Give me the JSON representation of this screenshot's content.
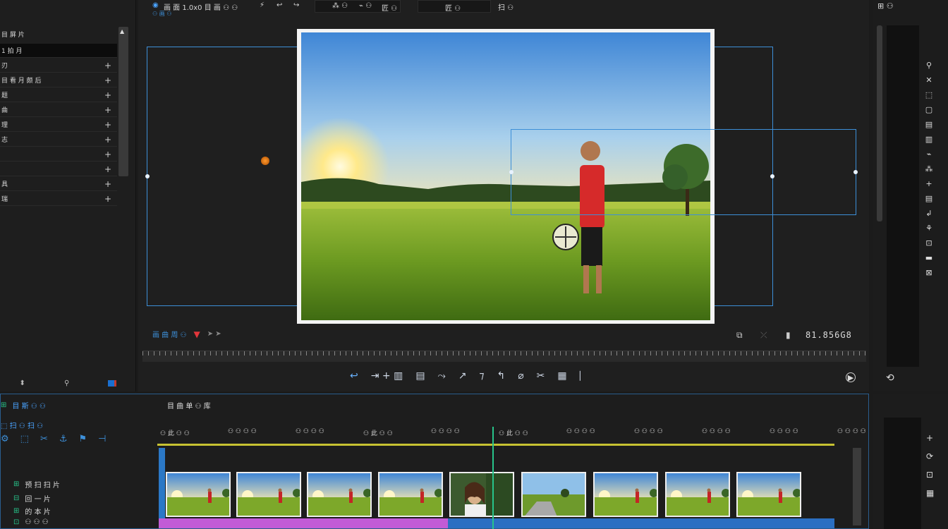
{
  "left_panel": {
    "header": "目 屏 片",
    "rows": [
      {
        "label": "1 拍 月",
        "selected": true,
        "plus": false,
        "back": "✚"
      },
      {
        "label": "刃",
        "selected": false,
        "plus": true
      },
      {
        "label": "目 看 月 颇 后",
        "selected": false,
        "plus": true
      },
      {
        "label": "题",
        "selected": false,
        "plus": true
      },
      {
        "label": "曲",
        "selected": false,
        "plus": true
      },
      {
        "label": "理",
        "selected": false,
        "plus": true
      },
      {
        "label": "志",
        "selected": false,
        "plus": true
      },
      {
        "label": "",
        "selected": false,
        "plus": true
      },
      {
        "label": "",
        "selected": false,
        "plus": true
      },
      {
        "label": "具",
        "selected": false,
        "plus": true
      },
      {
        "label": "瑞",
        "selected": false,
        "plus": true
      }
    ],
    "plus_symbol": "+",
    "bottom": {
      "left": "⬍",
      "mid": "⚲"
    }
  },
  "monitor": {
    "toolbar": {
      "title": "画 面 1.0x0 目 画 ⚇ ⚇",
      "subtitle": "⚇ 画 ⚇",
      "tools": [
        "⚡",
        "↩",
        "↪"
      ],
      "box1_a": "⁂ ⚇",
      "box1_b": "⌁ ⚇",
      "box1_c": "匠 ⚇",
      "box2": "匠 ⚇",
      "right_label": "扫 ⚇"
    },
    "controls": {
      "label": "画 曲 周 ⚇",
      "marker": "▼",
      "extra": "➤ ➤"
    },
    "timecode": "81.856G8",
    "right_icons": [
      "⧉",
      "⤫",
      "▮"
    ],
    "transport": [
      "↩",
      "⇥ + ▥",
      "▤",
      "⤳",
      "↗",
      "⁊",
      "↰",
      "⌀",
      "✂",
      "▦",
      "⎸"
    ],
    "play_icon": "▶"
  },
  "right_tools": {
    "top": "⊞ ⚇",
    "icons": [
      "⚲",
      "✕",
      "⬚",
      "▢",
      "▤",
      "▥",
      "⌁",
      "⁂",
      "+",
      "▤",
      "↲",
      "⚘",
      "⊡",
      "▬",
      "⊠"
    ],
    "bottom_icon": "⟲",
    "bottom_panel_icons": [
      "+",
      "⟳",
      "⊡",
      "▦"
    ]
  },
  "timeline": {
    "title": "目 曲 单 ⚇ 库",
    "left_rows": [
      {
        "label": "目 斯 ⚇ ⚇",
        "icon": "⊞"
      },
      {
        "label": "⬚ 扫 ⚇ 扫 ⚇",
        "icon": ""
      },
      {
        "label": "",
        "icon": ""
      },
      {
        "label": "预 扫 扫 片",
        "icon": "⊞"
      },
      {
        "label": "回 一 片",
        "icon": "⊟"
      },
      {
        "label": "的 本 片",
        "icon": "⊞"
      },
      {
        "label": "⚇ ⚇ ⚇",
        "icon": "⊡"
      }
    ],
    "tool_icons": [
      "⚙",
      "⬚",
      "✂",
      "⚓",
      "⚑",
      "⊣"
    ],
    "ruler_labels": [
      "⚇ 此 ⚇ ⚇",
      "⚇ ⚇ ⚇ ⚇",
      "⚇ ⚇ ⚇ ⚇",
      "⚇ 此 ⚇ ⚇",
      "⚇ ⚇ ⚇ ⚇",
      "⚇ 此 ⚇ ⚇",
      "⚇ ⚇ ⚇ ⚇",
      "⚇ ⚇ ⚇ ⚇",
      "⚇ ⚇ ⚇ ⚇",
      "⚇ ⚇ ⚇ ⚇",
      "⚇ ⚇ ⚇ ⚇"
    ],
    "clips": [
      {
        "type": "field"
      },
      {
        "type": "field"
      },
      {
        "type": "field"
      },
      {
        "type": "field"
      },
      {
        "type": "portrait"
      },
      {
        "type": "path"
      },
      {
        "type": "field"
      },
      {
        "type": "field"
      },
      {
        "type": "field"
      }
    ]
  },
  "colors": {
    "accent_blue": "#3d8fd8",
    "playhead": "#27c48a",
    "work_area": "#c7c231",
    "audio_purple": "#c25bd6",
    "audio_blue": "#2b6fc2"
  }
}
